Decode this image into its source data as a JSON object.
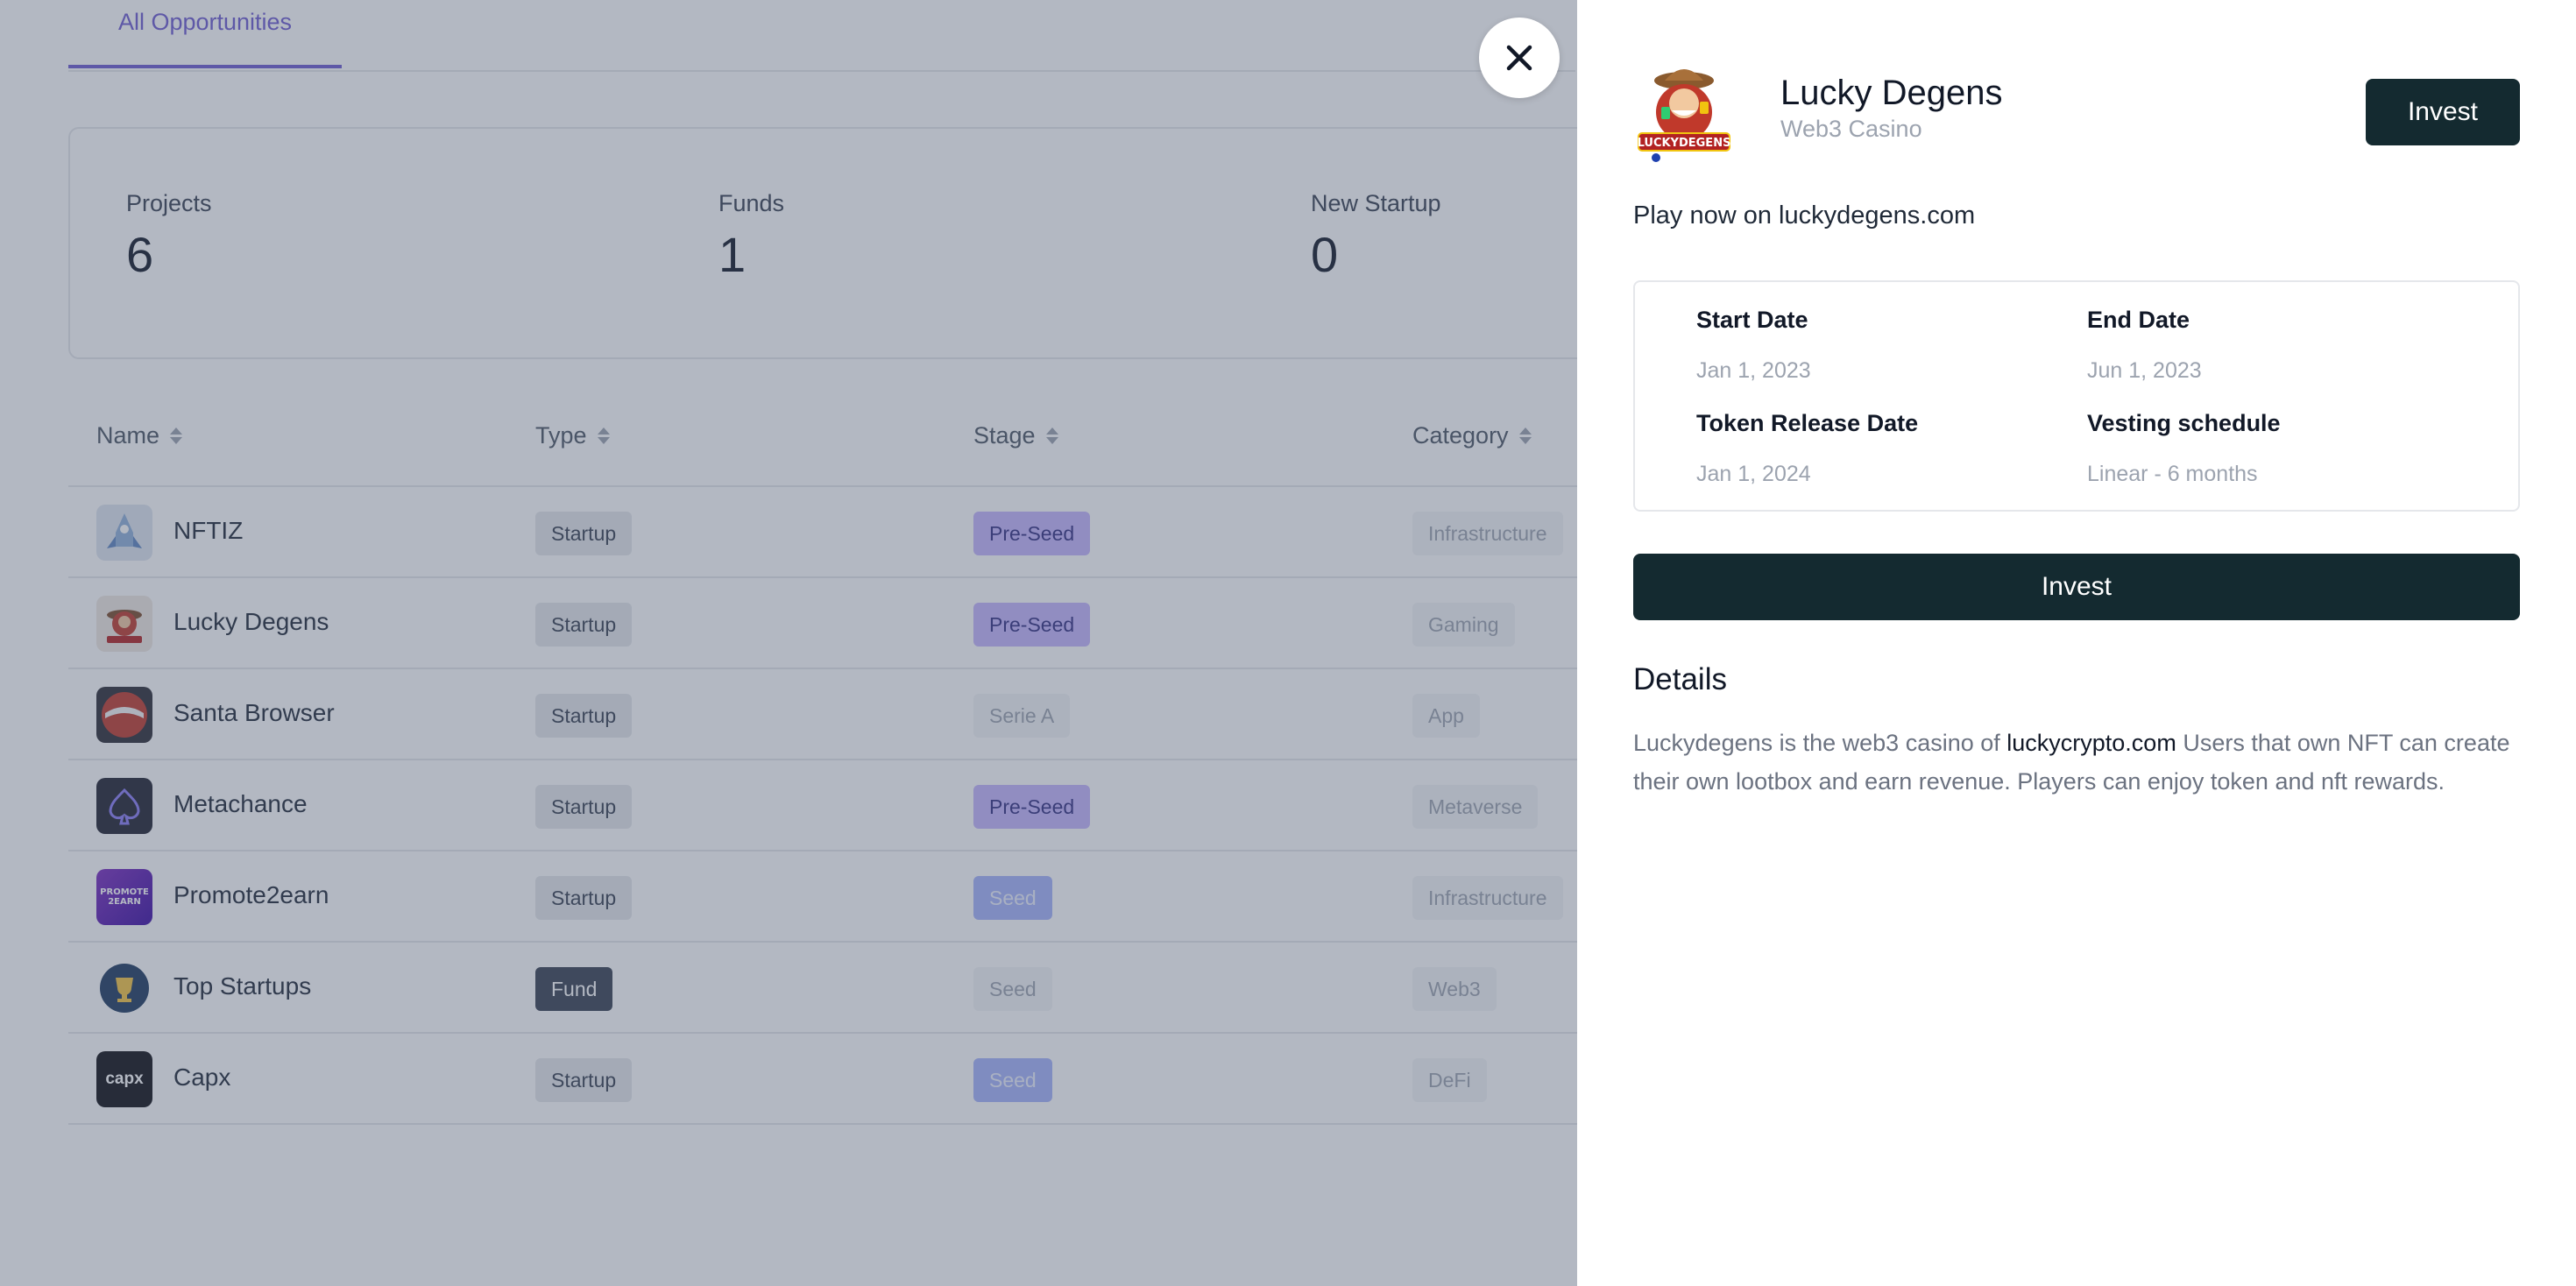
{
  "tabs": {
    "active": "All Opportunities"
  },
  "stats": [
    {
      "label": "Projects",
      "value": "6"
    },
    {
      "label": "Funds",
      "value": "1"
    },
    {
      "label": "New Startup",
      "value": "0"
    }
  ],
  "table": {
    "headers": {
      "name": "Name",
      "type": "Type",
      "stage": "Stage",
      "category": "Category"
    },
    "rows": [
      {
        "name": "NFTIZ",
        "type": "Startup",
        "stage": "Pre-Seed",
        "category": "Infrastructure"
      },
      {
        "name": "Lucky Degens",
        "type": "Startup",
        "stage": "Pre-Seed",
        "category": "Gaming"
      },
      {
        "name": "Santa Browser",
        "type": "Startup",
        "stage": "Serie A",
        "category": "App"
      },
      {
        "name": "Metachance",
        "type": "Startup",
        "stage": "Pre-Seed",
        "category": "Metaverse"
      },
      {
        "name": "Promote2earn",
        "type": "Startup",
        "stage": "Seed",
        "category": "Infrastructure"
      },
      {
        "name": "Top Startups",
        "type": "Fund",
        "stage": "Seed",
        "category": "Web3"
      },
      {
        "name": "Capx",
        "type": "Startup",
        "stage": "Seed",
        "category": "DeFi"
      }
    ],
    "logo_texts": {
      "promote": "PROMOTE\n2EARN",
      "capx": "capx"
    }
  },
  "panel": {
    "title": "Lucky Degens",
    "subtitle": "Web3 Casino",
    "invest_label": "Invest",
    "tagline": "Play now on luckydegens.com",
    "logo_text": "LUCKYDEGENS",
    "info": {
      "start_date_label": "Start Date",
      "start_date": "Jan 1, 2023",
      "end_date_label": "End Date",
      "end_date": "Jun 1, 2023",
      "token_release_label": "Token Release Date",
      "token_release": "Jan 1, 2024",
      "vesting_label": "Vesting schedule",
      "vesting": "Linear - 6 months"
    },
    "invest_wide_label": "Invest",
    "details_heading": "Details",
    "details_text_1": "Luckydegens is the web3 casino of ",
    "details_link": "luckycrypto.com",
    "details_text_2": " Users that own NFT can create their own lootbox and earn revenue. Players can enjoy token and nft rewards."
  },
  "colors": {
    "accent": "#6d5bd0",
    "dark_button": "#142a30",
    "overlay": "rgba(75,85,110,0.42)"
  }
}
